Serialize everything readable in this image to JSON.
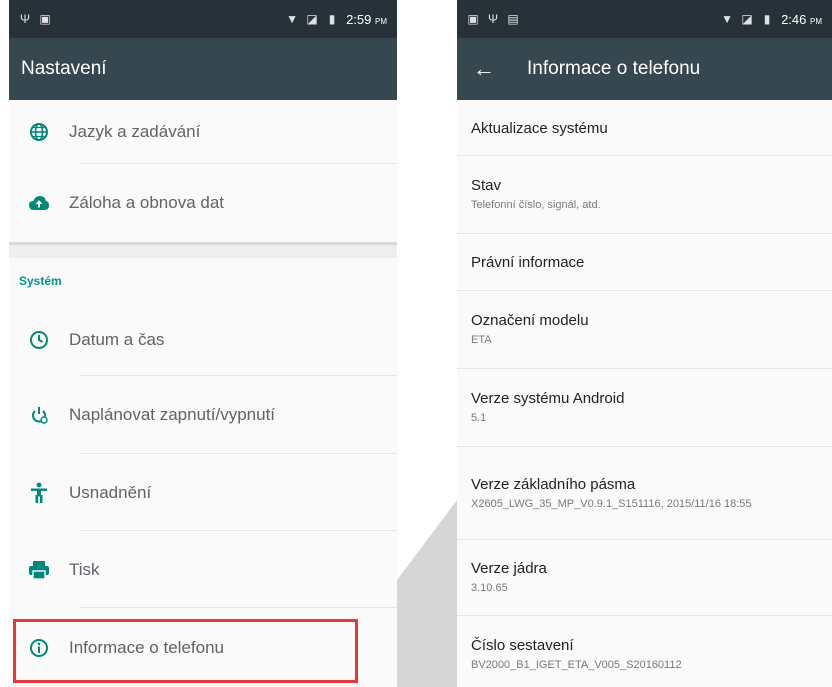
{
  "left_screen": {
    "status_time": "2:59",
    "status_ampm": "PM",
    "title": "Nastavení",
    "items_top": [
      {
        "icon": "globe-icon",
        "label": "Jazyk a zadávání"
      },
      {
        "icon": "cloud-upload-icon",
        "label": "Záloha a obnova dat"
      }
    ],
    "section_title": "Systém",
    "items_system": [
      {
        "icon": "clock-icon",
        "label": "Datum a čas"
      },
      {
        "icon": "power-schedule-icon",
        "label": "Naplánovat zapnutí/vypnutí"
      },
      {
        "icon": "accessibility-icon",
        "label": "Usnadnění"
      },
      {
        "icon": "print-icon",
        "label": "Tisk"
      },
      {
        "icon": "info-icon",
        "label": "Informace o telefonu"
      }
    ]
  },
  "right_screen": {
    "status_time": "2:46",
    "status_ampm": "PM",
    "title": "Informace o telefonu",
    "items": [
      {
        "title": "Aktualizace systému",
        "subtitle": ""
      },
      {
        "title": "Stav",
        "subtitle": "Telefonní číslo, signál, atd."
      },
      {
        "title": "Právní informace",
        "subtitle": ""
      },
      {
        "title": "Označení modelu",
        "subtitle": "ETA"
      },
      {
        "title": "Verze systému Android",
        "subtitle": "5.1"
      },
      {
        "title": "Verze základního pásma",
        "subtitle": "X2605_LWG_35_MP_V0.9.1_S151116, 2015/11/16 18:55"
      },
      {
        "title": "Verze jádra",
        "subtitle": "3.10.65"
      },
      {
        "title": "Číslo sestavení",
        "subtitle": "BV2000_B1_IGET_ETA_V005_S20160112"
      }
    ]
  },
  "colors": {
    "icon_teal": "#00897b",
    "highlight": "#e53935",
    "appbar": "#37474f",
    "statusbar": "#263238"
  }
}
